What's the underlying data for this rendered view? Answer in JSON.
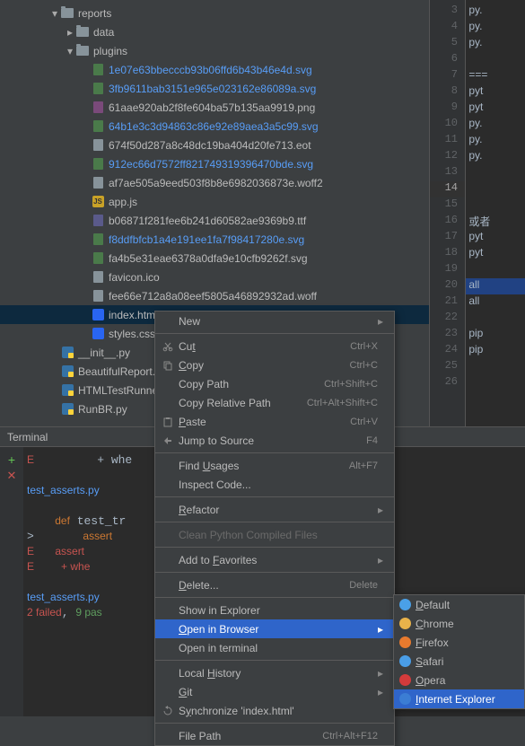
{
  "tree": {
    "reports": "reports",
    "data": "data",
    "plugins": "plugins",
    "files": [
      {
        "name": "1e07e63bbecccb93b06ffd6b43b46e4d.svg",
        "link": true,
        "type": "svg"
      },
      {
        "name": "3fb9611bab3151e965e023162e86089a.svg",
        "link": true,
        "type": "svg"
      },
      {
        "name": "61aae920ab2f8fe604ba57b135aa9919.png",
        "link": false,
        "type": "png"
      },
      {
        "name": "64b1e3c3d94863c86e92e89aea3a5c99.svg",
        "link": true,
        "type": "svg"
      },
      {
        "name": "674f50d287a8c48dc19ba404d20fe713.eot",
        "link": false,
        "type": "file"
      },
      {
        "name": "912ec66d7572ff821749319396470bde.svg",
        "link": true,
        "type": "svg"
      },
      {
        "name": "af7ae505a9eed503f8b8e6982036873e.woff2",
        "link": false,
        "type": "file"
      },
      {
        "name": "app.js",
        "link": false,
        "type": "js"
      },
      {
        "name": "b06871f281fee6b241d60582ae9369b9.ttf",
        "link": false,
        "type": "ttf"
      },
      {
        "name": "f8ddfbfcb1a4e191ee1fa7f98417280e.svg",
        "link": true,
        "type": "svg"
      },
      {
        "name": "fa4b5e31eae6378a0dfa9e10cfb9262f.svg",
        "link": false,
        "type": "svg"
      },
      {
        "name": "favicon.ico",
        "link": false,
        "type": "file"
      },
      {
        "name": "fee66e712a8a08eef5805a46892932ad.woff",
        "link": false,
        "type": "file"
      }
    ],
    "index": "index.html",
    "styles": "styles.css",
    "py": [
      {
        "name": "__init__.py"
      },
      {
        "name": "BeautifulReport."
      },
      {
        "name": "HTMLTestRunner"
      },
      {
        "name": "RunBR.py"
      }
    ]
  },
  "editor": {
    "lines": [
      3,
      4,
      5,
      6,
      7,
      8,
      9,
      10,
      11,
      12,
      13,
      14,
      15,
      16,
      17,
      18,
      19,
      20,
      21,
      22,
      23,
      24,
      25,
      26
    ],
    "cur": 14,
    "content": {
      "3": "py.",
      "4": "py.",
      "5": "py.",
      "6": "",
      "7": "===",
      "8": "pyt",
      "9": "pyt",
      "10": "py.",
      "11": "py.",
      "12": "py.",
      "13": "",
      "14": "",
      "15": "",
      "16": "或者",
      "17": "pyt",
      "18": "pyt",
      "19": "",
      "20": "all",
      "21": "all",
      "22": "",
      "23": "pip",
      "24": "pip",
      "25": "",
      "26": ""
    }
  },
  "terminal": {
    "title": "Terminal",
    "lines": [
      "E         + whe",
      "",
      "test_asserts.py",
      "",
      "    def test_tr",
      ">       assert ",
      "E       assert ",
      "E         + whe",
      "",
      "test_asserts.py",
      "2 failed, 9 pas"
    ]
  },
  "menu": {
    "items": [
      {
        "label": "New",
        "sub": true
      },
      {
        "sep": true
      },
      {
        "label": "Cut",
        "sc": "Ctrl+X",
        "ico": "cut",
        "u": "t"
      },
      {
        "label": "Copy",
        "sc": "Ctrl+C",
        "ico": "copy",
        "u": "C"
      },
      {
        "label": "Copy Path",
        "sc": "Ctrl+Shift+C"
      },
      {
        "label": "Copy Relative Path",
        "sc": "Ctrl+Alt+Shift+C"
      },
      {
        "label": "Paste",
        "sc": "Ctrl+V",
        "ico": "paste",
        "u": "P"
      },
      {
        "label": "Jump to Source",
        "sc": "F4",
        "ico": "jump"
      },
      {
        "sep": true
      },
      {
        "label": "Find Usages",
        "sc": "Alt+F7",
        "u": "U"
      },
      {
        "label": "Inspect Code..."
      },
      {
        "sep": true
      },
      {
        "label": "Refactor",
        "sub": true,
        "u": "R"
      },
      {
        "sep": true
      },
      {
        "label": "Clean Python Compiled Files",
        "dis": true
      },
      {
        "sep": true
      },
      {
        "label": "Add to Favorites",
        "sub": true,
        "u": "F"
      },
      {
        "sep": true
      },
      {
        "label": "Delete...",
        "sc": "Delete",
        "u": "D"
      },
      {
        "sep": true
      },
      {
        "label": "Show in Explorer"
      },
      {
        "label": "Open in Browser",
        "sub": true,
        "hl": true,
        "u": "O"
      },
      {
        "label": "Open in terminal"
      },
      {
        "sep": true
      },
      {
        "label": "Local History",
        "sub": true,
        "u": "H"
      },
      {
        "label": "Git",
        "sub": true,
        "u": "G"
      },
      {
        "label": "Synchronize 'index.html'",
        "ico": "sync",
        "u": "y"
      },
      {
        "sep": true
      },
      {
        "label": "File Path",
        "sc": "Ctrl+Alt+F12"
      }
    ]
  },
  "submenu": {
    "items": [
      {
        "label": "Default",
        "color": "#4aa0e8",
        "u": "D"
      },
      {
        "label": "Chrome",
        "color": "#e8b24a",
        "u": "C"
      },
      {
        "label": "Firefox",
        "color": "#e87a2e",
        "u": "F"
      },
      {
        "label": "Safari",
        "color": "#4a9ee8",
        "u": "S"
      },
      {
        "label": "Opera",
        "color": "#d43b3b",
        "u": "O"
      },
      {
        "label": "Internet Explorer",
        "color": "#3b7dd4",
        "hl": true,
        "u": "I"
      }
    ]
  }
}
